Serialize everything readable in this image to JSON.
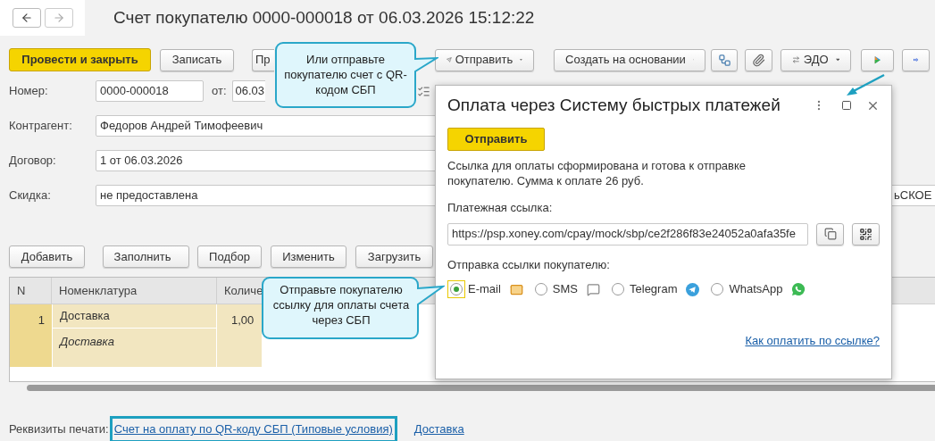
{
  "window": {
    "title": "Счет покупателю 0000-000018 от 06.03.2026 15:12:22"
  },
  "toolbar": {
    "post_close": "Провести и закрыть",
    "save": "Записать",
    "print": "Пр",
    "send": "Отправить",
    "create_based": "Создать на основании",
    "edo": "ЭДО"
  },
  "fields": {
    "number": {
      "label": "Номер:",
      "value": "0000-000018"
    },
    "date": {
      "label": "от:",
      "value": "06.03"
    },
    "counterparty": {
      "label": "Контрагент:",
      "value": "Федоров Андрей Тимофеевич"
    },
    "contract": {
      "label": "Договор:",
      "value": "1 от 06.03.2026"
    },
    "discount": {
      "label": "Скидка:",
      "value": "не предоставлена"
    },
    "right_fragment": "ьСКОЕ"
  },
  "table_buttons": [
    {
      "label": "Добавить",
      "menu": false
    },
    {
      "label": "Заполнить",
      "menu": true
    },
    {
      "label": "Подбор",
      "menu": false
    },
    {
      "label": "Изменить",
      "menu": false
    },
    {
      "label": "Загрузить",
      "menu": false
    }
  ],
  "table": {
    "columns": [
      "N",
      "Номенклатура",
      "Количе"
    ],
    "rows": [
      {
        "n": "1",
        "item": "Доставка",
        "content": "Доставка",
        "quantity": "1,00",
        "selected": true
      }
    ]
  },
  "print": {
    "label": "Реквизиты печати:",
    "links": [
      {
        "text": "Счет на оплату по QR-коду СБП (Типовые условия)",
        "highlighted": true
      },
      {
        "text": "Доставка",
        "highlighted": false
      }
    ]
  },
  "dialog": {
    "title": "Оплата через Систему быстрых платежей",
    "send_button": "Отправить",
    "message": "Ссылка для оплаты сформирована и готова к отправке покупателю. Сумма к оплате 26 руб.",
    "link_label": "Платежная ссылка:",
    "link_value": "https://psp.xoney.com/cpay/mock/sbp/ce2f286f83e24052a0afa35fe",
    "send_label": "Отправка ссылки покупателю:",
    "channels": [
      {
        "kind": "email",
        "label": "E-mail",
        "selected": true
      },
      {
        "kind": "sms",
        "label": "SMS",
        "selected": false
      },
      {
        "kind": "telegram",
        "label": "Telegram",
        "selected": false
      },
      {
        "kind": "whatsapp",
        "label": "WhatsApp",
        "selected": false
      }
    ],
    "help_link": "Как оплатить по ссылке?"
  },
  "callouts": [
    {
      "text": "Или отправьте покупателю счет с QR-кодом СБП"
    },
    {
      "text": "Отправьте покупателю ссылку для оплаты счета через СБП"
    }
  ]
}
